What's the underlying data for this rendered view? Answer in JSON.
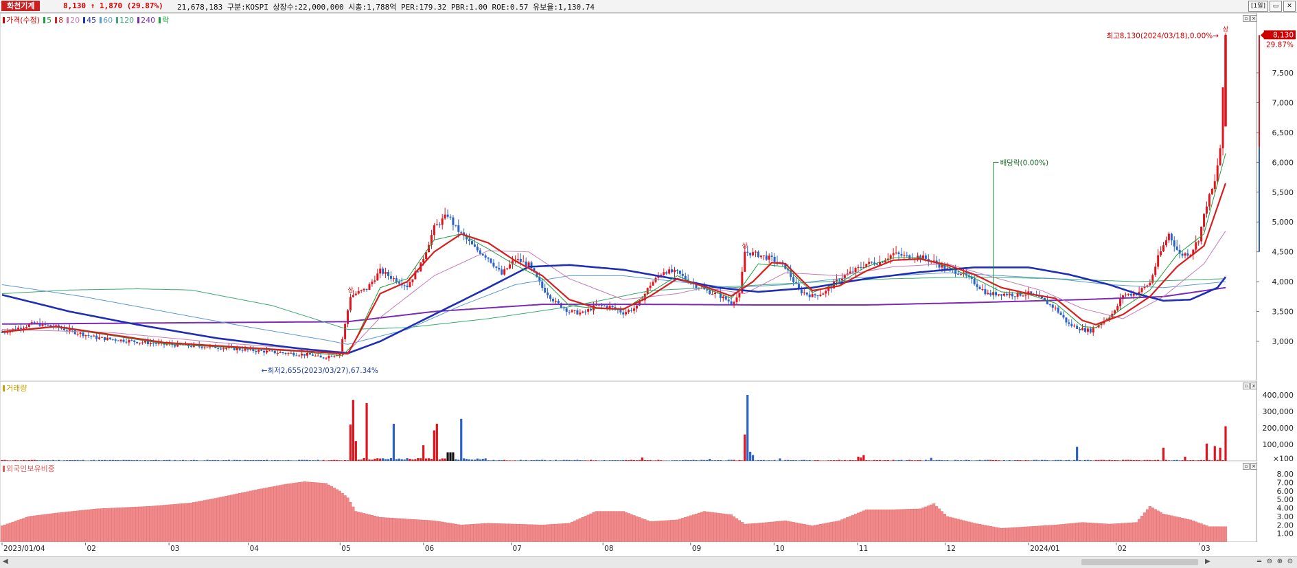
{
  "header": {
    "stock_name": "화천기계",
    "price": "8,130",
    "change_arrow": "↑",
    "change": "1,870",
    "change_pct": "(29.87%)",
    "stats": "21,678,183  구분:KOSPI 상장수:22,000,000 시총:1,788억 PER:179.32 PBR:1.00 ROE:0.57 유보율:1,130.74",
    "period_button": "[1일]",
    "min_button": "▭",
    "close_button": "✕"
  },
  "price_pane": {
    "legend": {
      "price": "가격(수정)",
      "ma5": "5",
      "ma8": "8",
      "ma20": "20",
      "ma45": "45",
      "ma60": "60",
      "ma120": "120",
      "ma240": "240",
      "ex": "락"
    },
    "annotations": {
      "high": "최고8,130(2024/03/18),0.00%→",
      "low": "←최저2,655(2023/03/27),67.34%",
      "dividend": "배당락(0.00%)",
      "limit_up": "상"
    },
    "current_price_tag": "8,130",
    "current_pct_tag": "29.87%",
    "y_ticks": [
      "7,500",
      "7,000",
      "6,500",
      "6,000",
      "5,500",
      "5,000",
      "4,500",
      "4,000",
      "3,500",
      "3,000"
    ]
  },
  "volume_pane": {
    "title": "거래량",
    "y_ticks": [
      "400,000",
      "300,000",
      "200,000",
      "100,000",
      "×100"
    ]
  },
  "foreign_pane": {
    "title": "외국인보유비중",
    "y_ticks": [
      "8.00",
      "7.00",
      "6.00",
      "5.00",
      "4.00",
      "3.00",
      "2.00",
      "1.00"
    ]
  },
  "x_axis": {
    "labels": [
      "2023/01/04",
      "02",
      "03",
      "04",
      "05",
      "06",
      "07",
      "08",
      "09",
      "10",
      "11",
      "12",
      "2024/01",
      "02",
      "03"
    ]
  },
  "colors": {
    "up": "#e3131b",
    "down": "#2a62c8",
    "ma5": "#1c9e3a",
    "ma8": "#d81e1e",
    "ma20": "#c879b6",
    "ma45": "#1f2fb5",
    "ma60": "#5a9ad8",
    "ma120": "#3aa870",
    "ma240": "#7a2bb5"
  },
  "chart_data": {
    "type": "candlestick",
    "ylim": [
      2650,
      8250
    ],
    "anchors": {
      "close": [
        [
          0,
          3150
        ],
        [
          12,
          3300
        ],
        [
          20,
          3240
        ],
        [
          35,
          3060
        ],
        [
          60,
          2950
        ],
        [
          80,
          2900
        ],
        [
          100,
          2820
        ],
        [
          115,
          2770
        ],
        [
          118,
          2720
        ],
        [
          125,
          2800
        ],
        [
          129,
          3760
        ],
        [
          135,
          3880
        ],
        [
          140,
          4180
        ],
        [
          145,
          4050
        ],
        [
          150,
          3930
        ],
        [
          155,
          4280
        ],
        [
          160,
          4900
        ],
        [
          165,
          5120
        ],
        [
          168,
          4900
        ],
        [
          170,
          4800
        ],
        [
          175,
          4560
        ],
        [
          180,
          4400
        ],
        [
          185,
          4120
        ],
        [
          190,
          4380
        ],
        [
          195,
          4280
        ],
        [
          200,
          3900
        ],
        [
          205,
          3650
        ],
        [
          210,
          3500
        ],
        [
          215,
          3470
        ],
        [
          220,
          3600
        ],
        [
          225,
          3580
        ],
        [
          230,
          3480
        ],
        [
          235,
          3570
        ],
        [
          240,
          3950
        ],
        [
          245,
          4180
        ],
        [
          250,
          4150
        ],
        [
          255,
          3980
        ],
        [
          260,
          3860
        ],
        [
          265,
          3780
        ],
        [
          270,
          3650
        ],
        [
          273,
          3780
        ],
        [
          275,
          4500
        ],
        [
          280,
          4450
        ],
        [
          285,
          4380
        ],
        [
          290,
          4250
        ],
        [
          295,
          3850
        ],
        [
          300,
          3760
        ],
        [
          305,
          3830
        ],
        [
          310,
          4050
        ],
        [
          315,
          4170
        ],
        [
          320,
          4300
        ],
        [
          325,
          4330
        ],
        [
          330,
          4470
        ],
        [
          335,
          4420
        ],
        [
          340,
          4420
        ],
        [
          345,
          4330
        ],
        [
          350,
          4200
        ],
        [
          355,
          4150
        ],
        [
          360,
          3980
        ],
        [
          365,
          3790
        ],
        [
          370,
          3800
        ],
        [
          375,
          3780
        ],
        [
          380,
          3800
        ],
        [
          385,
          3700
        ],
        [
          390,
          3550
        ],
        [
          395,
          3280
        ],
        [
          400,
          3200
        ],
        [
          403,
          3180
        ],
        [
          408,
          3350
        ],
        [
          412,
          3500
        ],
        [
          415,
          3780
        ],
        [
          420,
          3800
        ],
        [
          425,
          3980
        ],
        [
          428,
          4400
        ],
        [
          432,
          4800
        ],
        [
          436,
          4450
        ],
        [
          440,
          4480
        ],
        [
          443,
          4720
        ],
        [
          446,
          5300
        ],
        [
          449,
          5660
        ],
        [
          451,
          6240
        ],
        [
          453,
          8130
        ]
      ],
      "ma5": [
        [
          0,
          3150
        ],
        [
          20,
          3240
        ],
        [
          60,
          2960
        ],
        [
          110,
          2830
        ],
        [
          126,
          2760
        ],
        [
          130,
          2950
        ],
        [
          140,
          3900
        ],
        [
          150,
          4050
        ],
        [
          160,
          4700
        ],
        [
          170,
          4800
        ],
        [
          180,
          4550
        ],
        [
          190,
          4280
        ],
        [
          200,
          4050
        ],
        [
          210,
          3600
        ],
        [
          220,
          3550
        ],
        [
          230,
          3530
        ],
        [
          240,
          3820
        ],
        [
          250,
          4100
        ],
        [
          260,
          3900
        ],
        [
          270,
          3720
        ],
        [
          275,
          3980
        ],
        [
          280,
          4300
        ],
        [
          290,
          4250
        ],
        [
          300,
          3820
        ],
        [
          310,
          3980
        ],
        [
          320,
          4250
        ],
        [
          330,
          4400
        ],
        [
          340,
          4400
        ],
        [
          350,
          4250
        ],
        [
          360,
          4060
        ],
        [
          370,
          3830
        ],
        [
          380,
          3790
        ],
        [
          390,
          3640
        ],
        [
          400,
          3250
        ],
        [
          405,
          3230
        ],
        [
          415,
          3560
        ],
        [
          425,
          3860
        ],
        [
          435,
          4450
        ],
        [
          445,
          4800
        ],
        [
          453,
          6150
        ]
      ],
      "ma8": [
        [
          0,
          3160
        ],
        [
          20,
          3250
        ],
        [
          60,
          2980
        ],
        [
          110,
          2840
        ],
        [
          128,
          2790
        ],
        [
          133,
          3200
        ],
        [
          140,
          3800
        ],
        [
          150,
          4000
        ],
        [
          160,
          4500
        ],
        [
          170,
          4800
        ],
        [
          180,
          4650
        ],
        [
          190,
          4350
        ],
        [
          200,
          4100
        ],
        [
          210,
          3700
        ],
        [
          220,
          3560
        ],
        [
          230,
          3540
        ],
        [
          240,
          3760
        ],
        [
          250,
          4050
        ],
        [
          260,
          3920
        ],
        [
          270,
          3760
        ],
        [
          278,
          4000
        ],
        [
          285,
          4320
        ],
        [
          290,
          4300
        ],
        [
          300,
          3850
        ],
        [
          310,
          3930
        ],
        [
          320,
          4180
        ],
        [
          330,
          4360
        ],
        [
          340,
          4380
        ],
        [
          350,
          4280
        ],
        [
          360,
          4120
        ],
        [
          370,
          3900
        ],
        [
          380,
          3800
        ],
        [
          390,
          3720
        ],
        [
          400,
          3350
        ],
        [
          405,
          3280
        ],
        [
          415,
          3450
        ],
        [
          425,
          3750
        ],
        [
          435,
          4250
        ],
        [
          445,
          4600
        ],
        [
          453,
          5650
        ]
      ],
      "ma20": [
        [
          0,
          3200
        ],
        [
          40,
          3150
        ],
        [
          80,
          2980
        ],
        [
          110,
          2880
        ],
        [
          128,
          2820
        ],
        [
          140,
          3400
        ],
        [
          160,
          4100
        ],
        [
          180,
          4520
        ],
        [
          195,
          4500
        ],
        [
          210,
          4050
        ],
        [
          230,
          3700
        ],
        [
          250,
          3800
        ],
        [
          260,
          3900
        ],
        [
          275,
          3800
        ],
        [
          290,
          4150
        ],
        [
          310,
          4100
        ],
        [
          330,
          4250
        ],
        [
          350,
          4300
        ],
        [
          365,
          4100
        ],
        [
          385,
          3850
        ],
        [
          400,
          3550
        ],
        [
          415,
          3380
        ],
        [
          430,
          3750
        ],
        [
          445,
          4300
        ],
        [
          453,
          4850
        ]
      ],
      "ma45": [
        [
          0,
          3780
        ],
        [
          25,
          3500
        ],
        [
          50,
          3280
        ],
        [
          80,
          3050
        ],
        [
          110,
          2880
        ],
        [
          128,
          2800
        ],
        [
          140,
          3000
        ],
        [
          160,
          3450
        ],
        [
          180,
          3900
        ],
        [
          195,
          4250
        ],
        [
          210,
          4280
        ],
        [
          230,
          4200
        ],
        [
          250,
          4040
        ],
        [
          265,
          3900
        ],
        [
          280,
          3830
        ],
        [
          300,
          3900
        ],
        [
          320,
          4050
        ],
        [
          340,
          4160
        ],
        [
          360,
          4240
        ],
        [
          380,
          4240
        ],
        [
          395,
          4120
        ],
        [
          410,
          3950
        ],
        [
          420,
          3800
        ],
        [
          430,
          3680
        ],
        [
          440,
          3700
        ],
        [
          450,
          3900
        ],
        [
          453,
          4080
        ]
      ],
      "ma60": [
        [
          0,
          3950
        ],
        [
          30,
          3750
        ],
        [
          60,
          3500
        ],
        [
          90,
          3250
        ],
        [
          120,
          3020
        ],
        [
          128,
          2950
        ],
        [
          150,
          3200
        ],
        [
          170,
          3600
        ],
        [
          190,
          3950
        ],
        [
          210,
          4100
        ],
        [
          230,
          4100
        ],
        [
          250,
          4000
        ],
        [
          270,
          3900
        ],
        [
          290,
          3950
        ],
        [
          310,
          4050
        ],
        [
          330,
          4100
        ],
        [
          350,
          4150
        ],
        [
          370,
          4100
        ],
        [
          390,
          4050
        ],
        [
          410,
          3950
        ],
        [
          430,
          3900
        ],
        [
          453,
          4000
        ]
      ],
      "ma120": [
        [
          0,
          3800
        ],
        [
          25,
          3860
        ],
        [
          50,
          3880
        ],
        [
          70,
          3860
        ],
        [
          100,
          3600
        ],
        [
          128,
          3200
        ],
        [
          150,
          3230
        ],
        [
          180,
          3380
        ],
        [
          210,
          3580
        ],
        [
          240,
          3850
        ],
        [
          270,
          3920
        ],
        [
          300,
          3990
        ],
        [
          330,
          4050
        ],
        [
          360,
          4080
        ],
        [
          390,
          4050
        ],
        [
          420,
          4000
        ],
        [
          453,
          4050
        ]
      ],
      "ma240": [
        [
          0,
          3290
        ],
        [
          128,
          3330
        ],
        [
          160,
          3500
        ],
        [
          200,
          3620
        ],
        [
          240,
          3620
        ],
        [
          280,
          3610
        ],
        [
          320,
          3610
        ],
        [
          360,
          3650
        ],
        [
          400,
          3700
        ],
        [
          430,
          3750
        ],
        [
          453,
          3900
        ]
      ]
    },
    "volume_spikes": [
      [
        129,
        220000
      ],
      [
        130,
        370000
      ],
      [
        131,
        120000
      ],
      [
        135,
        350000
      ],
      [
        145,
        225000
      ],
      [
        156,
        95000
      ],
      [
        160,
        185000
      ],
      [
        161,
        225000
      ],
      [
        165,
        52000
      ],
      [
        166,
        52000
      ],
      [
        167,
        52000
      ],
      [
        170,
        255000
      ],
      [
        237,
        20000
      ],
      [
        262,
        12000
      ],
      [
        276,
        400000
      ],
      [
        275,
        160000
      ],
      [
        277,
        55000
      ],
      [
        278,
        35000
      ],
      [
        288,
        15000
      ],
      [
        317,
        25000
      ],
      [
        318,
        20000
      ],
      [
        319,
        35000
      ],
      [
        344,
        18000
      ],
      [
        398,
        85000
      ],
      [
        430,
        80000
      ],
      [
        438,
        25000
      ],
      [
        446,
        105000
      ],
      [
        449,
        90000
      ],
      [
        451,
        80000
      ],
      [
        453,
        210000
      ]
    ],
    "foreign_pct": [
      [
        0,
        1.9
      ],
      [
        10,
        3.0
      ],
      [
        20,
        3.4
      ],
      [
        35,
        3.9
      ],
      [
        55,
        4.2
      ],
      [
        70,
        4.6
      ],
      [
        80,
        5.2
      ],
      [
        95,
        6.2
      ],
      [
        105,
        6.8
      ],
      [
        112,
        7.1
      ],
      [
        120,
        6.9
      ],
      [
        125,
        6.0
      ],
      [
        128,
        5.2
      ],
      [
        131,
        3.6
      ],
      [
        140,
        2.9
      ],
      [
        150,
        2.7
      ],
      [
        160,
        2.5
      ],
      [
        170,
        2.0
      ],
      [
        180,
        2.2
      ],
      [
        190,
        2.1
      ],
      [
        200,
        2.0
      ],
      [
        210,
        2.2
      ],
      [
        220,
        3.6
      ],
      [
        230,
        3.6
      ],
      [
        240,
        2.4
      ],
      [
        250,
        2.6
      ],
      [
        260,
        3.6
      ],
      [
        270,
        3.2
      ],
      [
        275,
        2.1
      ],
      [
        280,
        2.2
      ],
      [
        290,
        2.5
      ],
      [
        300,
        1.9
      ],
      [
        310,
        2.5
      ],
      [
        320,
        3.8
      ],
      [
        330,
        3.8
      ],
      [
        340,
        3.9
      ],
      [
        345,
        4.5
      ],
      [
        350,
        3.0
      ],
      [
        360,
        2.2
      ],
      [
        370,
        1.6
      ],
      [
        380,
        1.8
      ],
      [
        390,
        2.0
      ],
      [
        400,
        2.3
      ],
      [
        410,
        2.1
      ],
      [
        420,
        2.3
      ],
      [
        425,
        4.2
      ],
      [
        430,
        3.3
      ],
      [
        440,
        2.6
      ],
      [
        447,
        1.8
      ],
      [
        453,
        1.8
      ]
    ],
    "x_label_index": [
      0,
      20,
      40,
      59,
      81,
      101,
      122,
      144,
      165,
      185,
      205,
      226,
      246,
      267,
      287
    ]
  }
}
